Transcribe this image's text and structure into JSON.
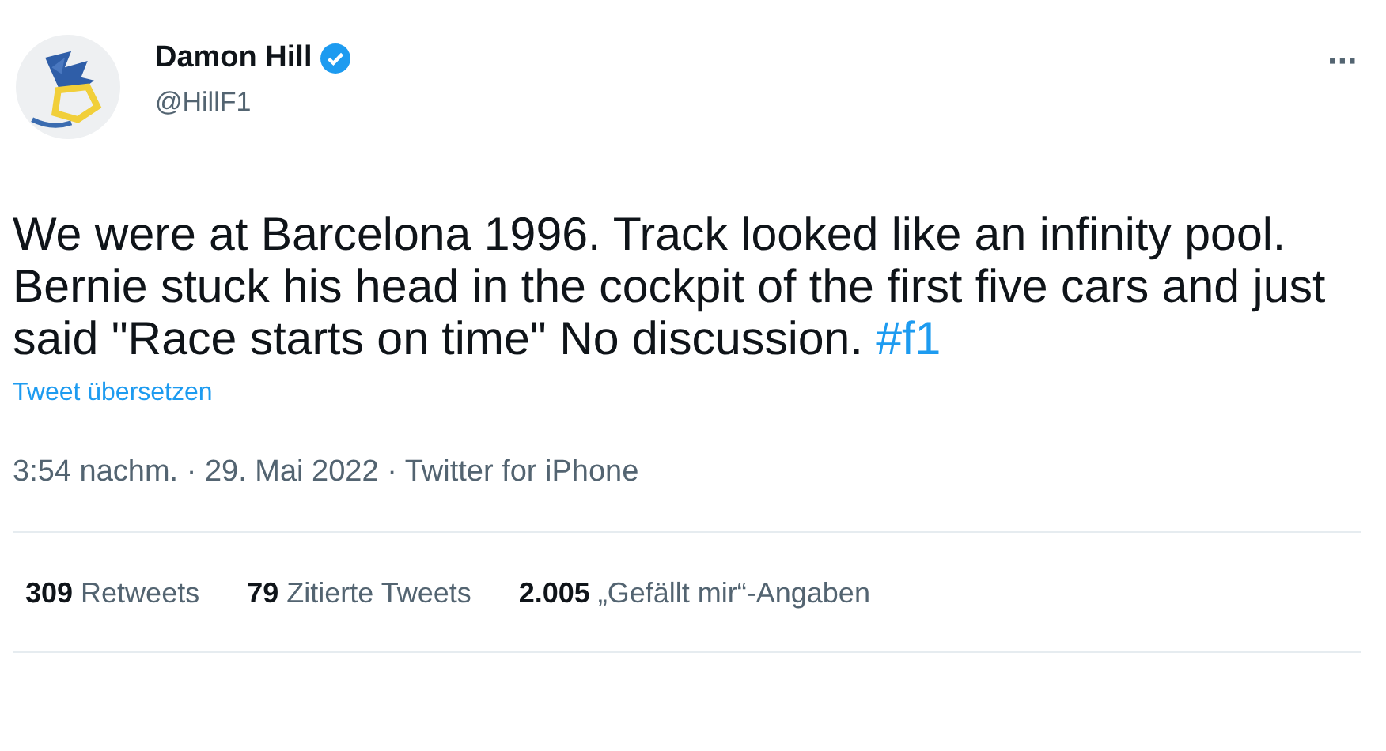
{
  "author": {
    "name": "Damon Hill",
    "verified": true,
    "handle": "@HillF1"
  },
  "menu": {
    "label": "···"
  },
  "tweet": {
    "text": "We were at Barcelona 1996. Track looked like an infinity pool. Bernie stuck his head in the cockpit of the first five cars and just said \"Race starts on time\" No discussion. ",
    "hashtag": "#f1"
  },
  "translate_link": "Tweet übersetzen",
  "meta": "3:54 nachm. · 29. Mai 2022 · Twitter for iPhone",
  "stats": [
    {
      "count": "309",
      "label": "Retweets"
    },
    {
      "count": "79",
      "label": "Zitierte Tweets"
    },
    {
      "count": "2.005",
      "label": "„Gefällt mir“-Angaben"
    }
  ]
}
